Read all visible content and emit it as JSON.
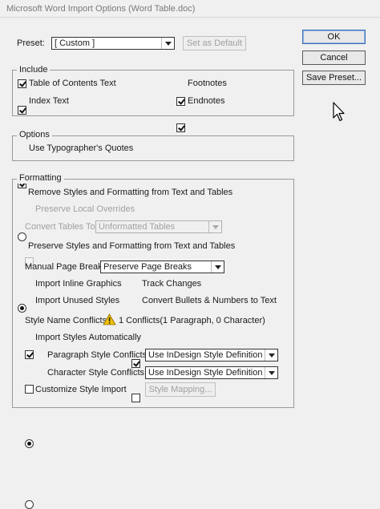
{
  "window": {
    "title": "Microsoft Word Import Options (Word Table.doc)"
  },
  "preset": {
    "label": "Preset:",
    "value": "[ Custom ]",
    "set_default": "Set as Default"
  },
  "buttons": {
    "ok": "OK",
    "cancel": "Cancel",
    "save_preset": "Save Preset..."
  },
  "include": {
    "title": "Include",
    "toc": "Table of Contents Text",
    "index": "Index Text",
    "footnotes": "Footnotes",
    "endnotes": "Endnotes"
  },
  "options": {
    "title": "Options",
    "typographers_quotes": "Use Typographer's Quotes"
  },
  "formatting": {
    "title": "Formatting",
    "remove_styles": "Remove Styles and Formatting from Text and Tables",
    "preserve_overrides": "Preserve Local Overrides",
    "convert_tables_label": "Convert Tables To:",
    "convert_tables_value": "Unformatted Tables",
    "preserve_styles": "Preserve Styles and Formatting from Text and Tables",
    "page_breaks_label": "Manual Page Breaks:",
    "page_breaks_value": "Preserve Page Breaks",
    "inline_graphics": "Import Inline Graphics",
    "track_changes": "Track Changes",
    "unused_styles": "Import Unused Styles",
    "convert_bullets": "Convert Bullets & Numbers to Text",
    "conflicts_label": "Style Name Conflicts:",
    "conflicts_value": "1 Conflicts(1 Paragraph, 0 Character)",
    "import_auto": "Import Styles Automatically",
    "para_conflicts_label": "Paragraph Style Conflicts:",
    "para_conflicts_value": "Use InDesign Style Definition",
    "char_conflicts_label": "Character Style Conflicts:",
    "char_conflicts_value": "Use InDesign Style Definition",
    "customize": "Customize Style Import",
    "style_mapping": "Style Mapping..."
  },
  "colors": {
    "warning": "#f2c200",
    "default_button_border": "#3b6fb3"
  },
  "icons": {
    "warning": "warning-icon",
    "cursor": "mouse-cursor-icon"
  }
}
